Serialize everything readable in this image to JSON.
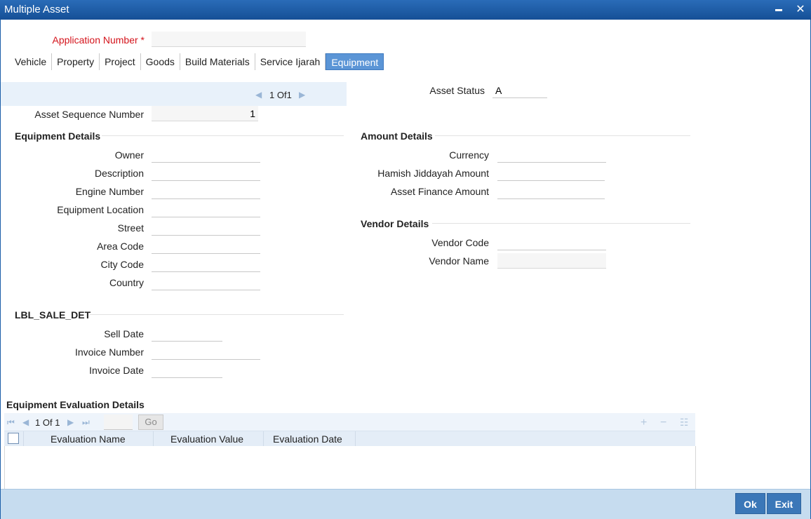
{
  "window": {
    "title": "Multiple Asset",
    "minimize_glyph": "▬",
    "close_glyph": "✕"
  },
  "header": {
    "application_number_label": "Application Number",
    "required_mark": "*",
    "application_number_value": ""
  },
  "tabs": [
    {
      "label": "Vehicle"
    },
    {
      "label": "Property"
    },
    {
      "label": "Project"
    },
    {
      "label": "Goods"
    },
    {
      "label": "Build Materials"
    },
    {
      "label": "Service Ijarah"
    },
    {
      "label": "Equipment",
      "active": true
    }
  ],
  "asset_pager": {
    "current": "1",
    "of_label": "Of",
    "total": "1"
  },
  "asset_status": {
    "label": "Asset Status",
    "value": "A"
  },
  "asset_sequence": {
    "label": "Asset Sequence Number",
    "value": "1"
  },
  "equipment_details": {
    "heading": "Equipment Details",
    "fields": {
      "owner": {
        "label": "Owner",
        "value": ""
      },
      "description": {
        "label": "Description",
        "value": ""
      },
      "engine_number": {
        "label": "Engine Number",
        "value": ""
      },
      "equipment_location": {
        "label": "Equipment Location",
        "value": ""
      },
      "street": {
        "label": "Street",
        "value": ""
      },
      "area_code": {
        "label": "Area Code",
        "value": ""
      },
      "city_code": {
        "label": "City Code",
        "value": ""
      },
      "country": {
        "label": "Country",
        "value": ""
      }
    }
  },
  "amount_details": {
    "heading": "Amount Details",
    "fields": {
      "currency": {
        "label": "Currency",
        "value": ""
      },
      "hamish": {
        "label": "Hamish Jiddayah Amount",
        "value": ""
      },
      "finance": {
        "label": "Asset Finance Amount",
        "value": ""
      }
    }
  },
  "vendor_details": {
    "heading": "Vendor Details",
    "fields": {
      "code": {
        "label": "Vendor Code",
        "value": ""
      },
      "name": {
        "label": "Vendor Name",
        "value": ""
      }
    }
  },
  "sale_details": {
    "heading": "LBL_SALE_DET",
    "fields": {
      "sell_date": {
        "label": "Sell Date",
        "value": ""
      },
      "invoice_number": {
        "label": "Invoice Number",
        "value": ""
      },
      "invoice_date": {
        "label": "Invoice Date",
        "value": ""
      }
    }
  },
  "evaluation_grid": {
    "heading": "Equipment Evaluation Details",
    "pager": {
      "current": "1",
      "of_label": "Of",
      "total": "1",
      "go_label": "Go"
    },
    "columns": [
      "Evaluation Name",
      "Evaluation Value",
      "Evaluation Date"
    ],
    "icons": {
      "first": "first-page-icon",
      "prev": "prev-page-icon",
      "next": "next-page-icon",
      "last": "last-page-icon",
      "add": "plus-icon",
      "delete": "minus-icon",
      "view": "list-view-icon"
    },
    "rows": []
  },
  "footer": {
    "ok_label": "Ok",
    "exit_label": "Exit"
  },
  "colors": {
    "title_bar": "#1c5ea8",
    "active_tab": "#5b95d6",
    "required": "#d4141c",
    "button": "#3b77b8",
    "footer": "#c6dcef"
  }
}
